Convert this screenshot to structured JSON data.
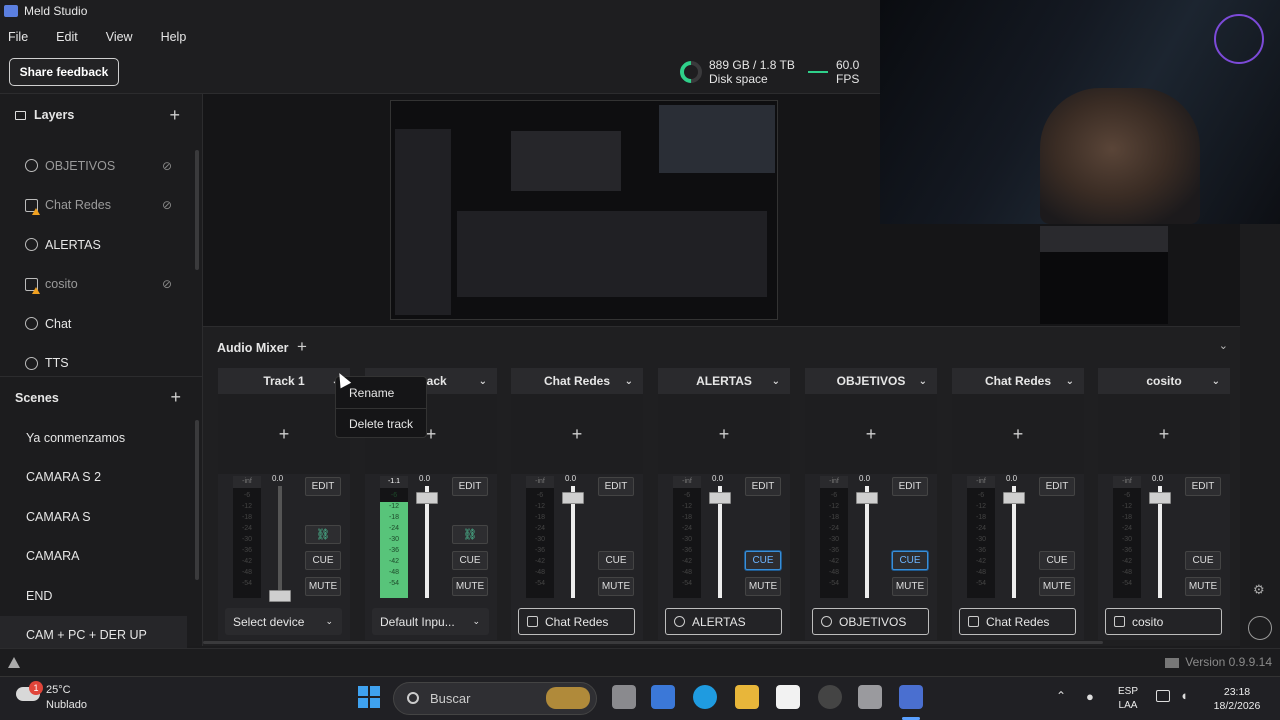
{
  "app": {
    "title": "Meld Studio"
  },
  "menu": {
    "file": "File",
    "edit": "Edit",
    "view": "View",
    "help": "Help"
  },
  "toolbar": {
    "feedback_label": "Share feedback",
    "disk_value": "889 GB / 1.8 TB",
    "disk_label": "Disk space",
    "fps_value": "60.0",
    "fps_label": "FPS"
  },
  "layers": {
    "title": "Layers",
    "items": [
      {
        "label": "OBJETIVOS",
        "hidden": true
      },
      {
        "label": "Chat Redes",
        "hidden": true
      },
      {
        "label": "ALERTAS",
        "hidden": false
      },
      {
        "label": "cosito",
        "hidden": true
      },
      {
        "label": "Chat",
        "hidden": false
      },
      {
        "label": "TTS",
        "hidden": false
      }
    ]
  },
  "scenes": {
    "title": "Scenes",
    "items": [
      {
        "label": "Ya conmenzamos"
      },
      {
        "label": "CAMARA S 2"
      },
      {
        "label": "CAMARA S"
      },
      {
        "label": "CAMARA"
      },
      {
        "label": "END"
      },
      {
        "label": "CAM + PC + DER UP"
      }
    ]
  },
  "mixer": {
    "title": "Audio Mixer",
    "edit_label": "EDIT",
    "cue_label": "CUE",
    "mute_label": "MUTE",
    "tracks": [
      {
        "name": "Track 1",
        "meter_top": "-inf",
        "fader_value": "0.0",
        "source": "Select device"
      },
      {
        "name": "Track",
        "meter_top": "-1.1",
        "fader_value": "0.0",
        "source": "Default Inpu..."
      },
      {
        "name": "Chat Redes",
        "meter_top": "-inf",
        "fader_value": "0.0",
        "source": "Chat Redes"
      },
      {
        "name": "ALERTAS",
        "meter_top": "-inf",
        "fader_value": "0.0",
        "source": "ALERTAS"
      },
      {
        "name": "OBJETIVOS",
        "meter_top": "-inf",
        "fader_value": "0.0",
        "source": "OBJETIVOS"
      },
      {
        "name": "Chat Redes",
        "meter_top": "-inf",
        "fader_value": "0.0",
        "source": "Chat Redes"
      },
      {
        "name": "cosito",
        "meter_top": "-inf",
        "fader_value": "0.0",
        "source": "cosito"
      }
    ],
    "scale": [
      "-6",
      "-12",
      "-18",
      "-24",
      "-30",
      "-36",
      "-42",
      "-48",
      "-54"
    ]
  },
  "context_menu": {
    "rename": "Rename",
    "delete": "Delete track"
  },
  "status": {
    "version": "Version 0.9.9.14"
  },
  "taskbar": {
    "temp": "25°C",
    "weather": "Nublado",
    "weather_badge": "1",
    "search_placeholder": "Buscar",
    "lang_top": "ESP",
    "lang_bottom": "LAA",
    "time": "23:18",
    "date": "18/2/2026"
  }
}
